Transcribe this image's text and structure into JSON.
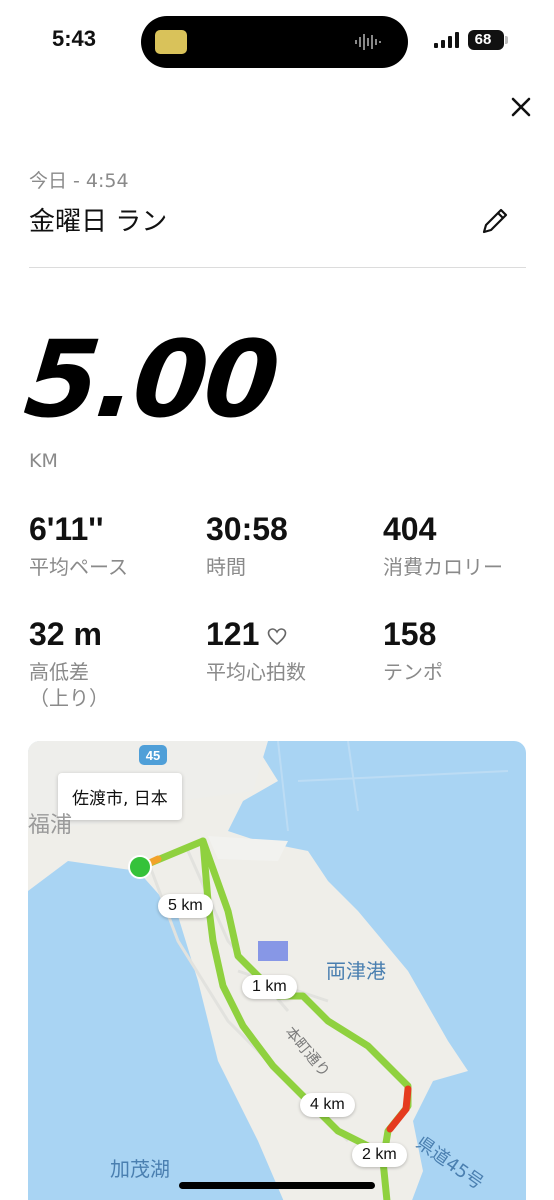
{
  "status_bar": {
    "time": "5:43",
    "battery": "68"
  },
  "header": {
    "date_line": "今日 - 4:54",
    "title": "金曜日 ラン"
  },
  "summary": {
    "distance": "5.00",
    "unit": "KM"
  },
  "stats": [
    {
      "value": "6'11''",
      "label": "平均ペース"
    },
    {
      "value": "30:58",
      "label": "時間"
    },
    {
      "value": "404",
      "label": "消費カロリー"
    },
    {
      "value": "32 m",
      "label": "高低差",
      "label2": "（上り）"
    },
    {
      "value": "121",
      "label": "平均心拍数"
    },
    {
      "value": "158",
      "label": "テンポ"
    }
  ],
  "map": {
    "location": "佐渡市, 日本",
    "km_markers": [
      "5 km",
      "1 km",
      "4 km",
      "2 km"
    ],
    "labels": {
      "harbor": "両津港",
      "street": "本町通り",
      "lake": "加茂湖",
      "town": "福浦",
      "road": "県道45号",
      "route_badge": "45"
    },
    "colors": {
      "water": "#a9d4f3",
      "route": "#8fd13f",
      "route_hot": "#e53b1f",
      "start": "#35c23a"
    }
  },
  "colors": {
    "accent": "#111111",
    "muted": "#8a8a8a"
  }
}
